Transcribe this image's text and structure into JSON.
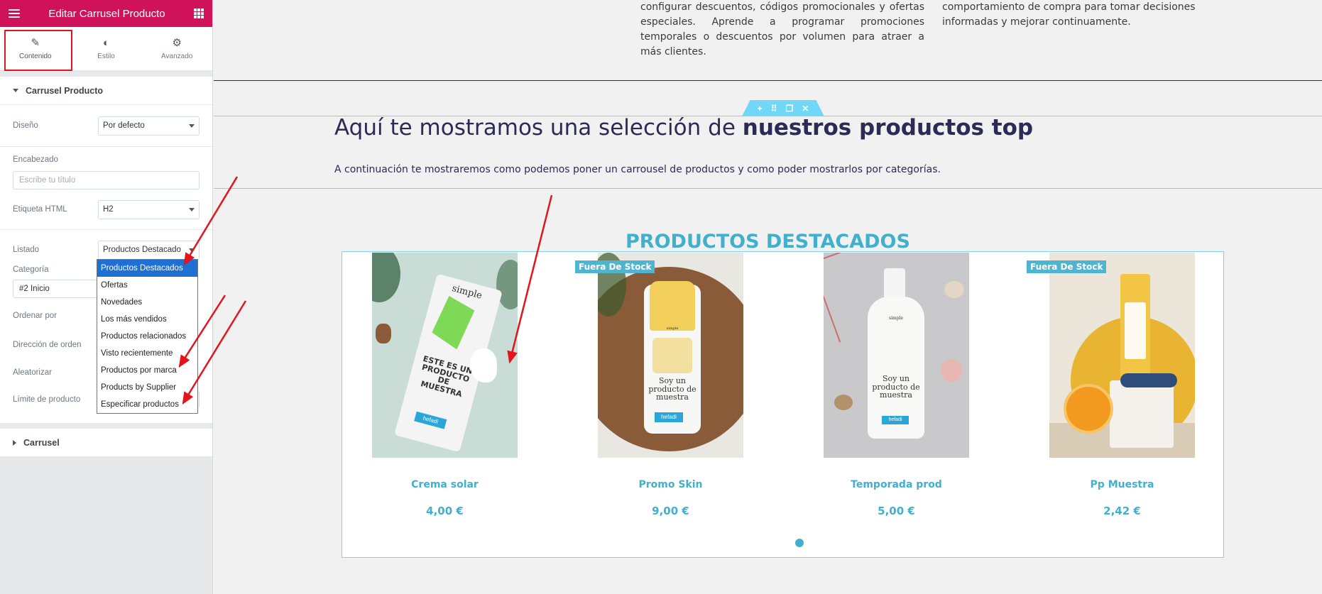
{
  "panel": {
    "title": "Editar Carrusel Producto",
    "tabs": [
      {
        "label": "Contenido",
        "icon": "pencil-icon"
      },
      {
        "label": "Estilo",
        "icon": "half-circle-icon"
      },
      {
        "label": "Avanzado",
        "icon": "gear-icon"
      }
    ],
    "section_main": "Carrusel Producto",
    "section_carousel": "Carrusel",
    "controls": {
      "diseno_label": "Diseño",
      "diseno_value": "Por defecto",
      "encabezado_label": "Encabezado",
      "encabezado_placeholder": "Escribe tu título",
      "etiqueta_label": "Etiqueta HTML",
      "etiqueta_value": "H2",
      "listado_label": "Listado",
      "listado_value": "Productos Destacado",
      "categoria_label": "Categoría",
      "categoria_value": "#2 Inicio",
      "ordenar_label": "Ordenar por",
      "direccion_label": "Dirección de orden",
      "aleatorizar_label": "Aleatorizar",
      "limite_label": "Límite de producto"
    },
    "dropdown_options": [
      "Productos Destacados",
      "Ofertas",
      "Novedades",
      "Los más vendidos",
      "Productos relacionados",
      "Visto recientemente",
      "Productos por marca",
      "Products by Supplier",
      "Especificar productos"
    ]
  },
  "preview": {
    "top_left_text": "configurar descuentos, códigos promocionales y ofertas especiales. Aprende a programar promociones temporales o descuentos por volumen para atraer a más clientes.",
    "top_right_text": "comportamiento de compra para tomar decisiones informadas y mejorar continuamente.",
    "headline_normal": "Aquí te mostramos una selección de ",
    "headline_bold": "nuestros productos top",
    "subline": "A continuación te mostraremos como podemos poner un carrousel de productos y como poder mostrarlos por categorías.",
    "carousel_title": "PRODUCTOS DESTACADOS",
    "products": [
      {
        "name": "Crema solar",
        "price": "4,00 €",
        "badge": ""
      },
      {
        "name": "Promo Skin",
        "price": "9,00 €",
        "badge": "Fuera De Stock"
      },
      {
        "name": "Temporada prod",
        "price": "5,00 €",
        "badge": ""
      },
      {
        "name": "Pp Muestra",
        "price": "2,42 €",
        "badge": "Fuera De Stock"
      }
    ],
    "tube1_text": "ESTE ES UN PRODUCTO DE MUESTRA",
    "brand": "simple",
    "sample_text": "Soy un producto de muestra",
    "logo": "hefadi"
  },
  "colors": {
    "brand_pink": "#d0125b",
    "accent_blue": "#42b0cd",
    "annotation_red": "#e3141b",
    "selection_blue": "#1e70d4"
  }
}
